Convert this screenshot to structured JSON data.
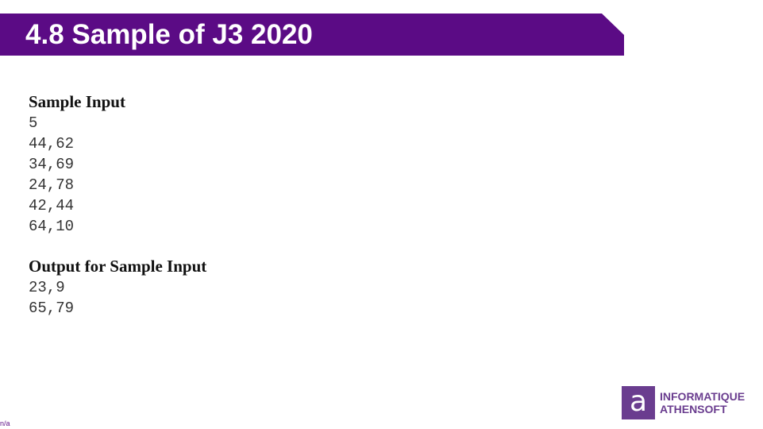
{
  "slide": {
    "title": "4.8 Sample of J3 2020",
    "footer_note": "n/a"
  },
  "sample_input": {
    "heading": "Sample Input",
    "lines": [
      "5",
      "44,62",
      "34,69",
      "24,78",
      "42,44",
      "64,10"
    ]
  },
  "sample_output": {
    "heading": "Output for Sample Input",
    "lines": [
      "23,9",
      "65,79"
    ]
  },
  "logo": {
    "mark": "a",
    "line1": "INFORMATIQUE",
    "line2": "ATHENSOFT"
  },
  "colors": {
    "title_bar": "#5b0b85",
    "logo": "#6a3d8f"
  }
}
